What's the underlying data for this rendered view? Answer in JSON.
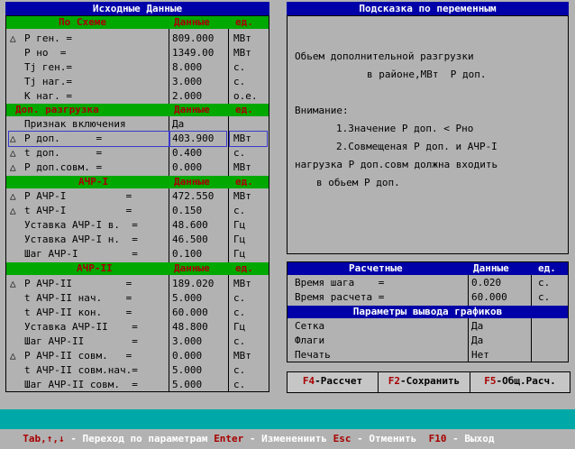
{
  "left_panel": {
    "title": "Исходные Данные",
    "section1": {
      "headers": [
        "По Схеме",
        "Данные",
        "ед."
      ],
      "rows": [
        {
          "mark": "△",
          "label": "Р ген. =",
          "value": "809.000",
          "unit": "МВт"
        },
        {
          "mark": "",
          "label": "Р но  =",
          "value": "1349.00",
          "unit": "МВт"
        },
        {
          "mark": "",
          "label": "Tj ген.=",
          "value": "8.000",
          "unit": "с."
        },
        {
          "mark": "",
          "label": "Tj наг.=",
          "value": "3.000",
          "unit": "с."
        },
        {
          "mark": "",
          "label": "К наг. =",
          "value": "2.000",
          "unit": "о.е."
        }
      ]
    },
    "section2": {
      "headers": [
        "Доп. разгрузка",
        "Данные",
        "ед."
      ],
      "rows": [
        {
          "mark": "",
          "label": "Признак включения",
          "value": "Да",
          "unit": ""
        },
        {
          "mark": "△",
          "label": "Р доп.      =",
          "value": "403.900",
          "unit": "МВт"
        },
        {
          "mark": "△",
          "label": "t доп.      =",
          "value": "0.400",
          "unit": "с."
        },
        {
          "mark": "△",
          "label": "Р доп.совм. =",
          "value": "0.000",
          "unit": "МВт"
        }
      ]
    },
    "section3": {
      "headers": [
        "АЧР-I",
        "Данные",
        "ед."
      ],
      "rows": [
        {
          "mark": "△",
          "label": "Р АЧР-I          =",
          "value": "472.550",
          "unit": "МВт"
        },
        {
          "mark": "△",
          "label": "t АЧР-I          =",
          "value": "0.150",
          "unit": "с."
        },
        {
          "mark": "",
          "label": "Уставка АЧР-I в.  =",
          "value": "48.600",
          "unit": "Гц"
        },
        {
          "mark": "",
          "label": "Уставка АЧР-I н.  =",
          "value": "46.500",
          "unit": "Гц"
        },
        {
          "mark": "",
          "label": "Шаг АЧР-I         =",
          "value": "0.100",
          "unit": "Гц"
        }
      ]
    },
    "section4": {
      "headers": [
        "АЧР-II",
        "Данные",
        "ед."
      ],
      "rows": [
        {
          "mark": "△",
          "label": "Р АЧР-II         =",
          "value": "189.020",
          "unit": "МВт"
        },
        {
          "mark": "",
          "label": "t АЧР-II нач.    =",
          "value": "5.000",
          "unit": "с."
        },
        {
          "mark": "",
          "label": "t АЧР-II кон.    =",
          "value": "60.000",
          "unit": "с."
        },
        {
          "mark": "",
          "label": "Уставка АЧР-II    =",
          "value": "48.800",
          "unit": "Гц"
        },
        {
          "mark": "",
          "label": "Шаг АЧР-II        =",
          "value": "3.000",
          "unit": "с."
        },
        {
          "mark": "△",
          "label": "Р АЧР-II совм.   =",
          "value": "0.000",
          "unit": "МВт"
        },
        {
          "mark": "",
          "label": "t АЧР-II совм.нач.=",
          "value": "5.000",
          "unit": "с."
        },
        {
          "mark": "",
          "label": "Шаг АЧР-II совм.  =",
          "value": "5.000",
          "unit": "с."
        }
      ]
    }
  },
  "hint_panel": {
    "title": "Подсказка по переменным",
    "lines": [
      "Обьем дополнительной разгрузки",
      "в районе,МВт  Р доп.",
      "Внимание:",
      "1.Значение Р доп. < Рно",
      "2.Совмещеная Р доп. и АЧР-I",
      "нагрузка Р доп.совм должна входить",
      "в обьем Р доп."
    ]
  },
  "calc_panel": {
    "headers": [
      "Расчетные",
      "Данные",
      "ед."
    ],
    "rows": [
      {
        "label": "Время шага    =",
        "value": "0.020",
        "unit": "с."
      },
      {
        "label": "Время расчета =",
        "value": "60.000",
        "unit": "с."
      }
    ],
    "graph_title": "Параметры вывода графиков",
    "graph_rows": [
      {
        "label": "Сетка",
        "value": "Да"
      },
      {
        "label": "Флаги",
        "value": "Да"
      },
      {
        "label": "Печать",
        "value": "Нет"
      }
    ]
  },
  "fkeys": [
    {
      "key": "F4",
      "label": "-Рассчет"
    },
    {
      "key": "F2",
      "label": "-Сохранить"
    },
    {
      "key": "F5",
      "label": "-Общ.Расч."
    }
  ],
  "status": {
    "k1": "Tab,↑,↓",
    "t1": " - Переход по параметрам ",
    "k2": "Enter",
    "t2": " - Изменениить ",
    "k3": "Esc",
    "t3": " - Отменить  ",
    "k4": "F10",
    "t4": " - Выход"
  }
}
